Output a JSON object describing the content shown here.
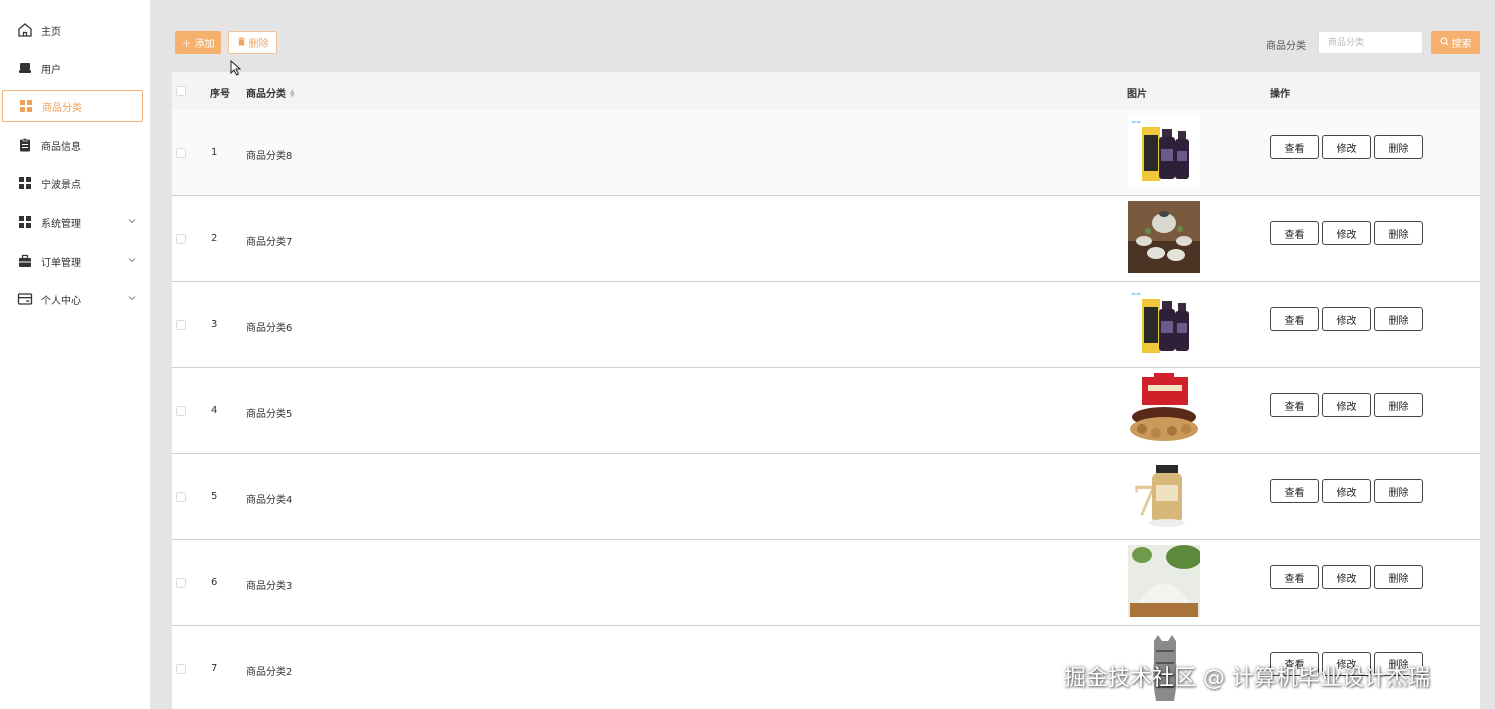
{
  "sidebar": {
    "items": [
      {
        "label": "主页",
        "icon": "home-icon"
      },
      {
        "label": "用户",
        "icon": "user-icon"
      },
      {
        "label": "商品分类",
        "icon": "grid-icon",
        "active": true
      },
      {
        "label": "商品信息",
        "icon": "clipboard-icon"
      },
      {
        "label": "宁波景点",
        "icon": "grid-icon"
      },
      {
        "label": "系统管理",
        "icon": "grid-icon",
        "expandable": true
      },
      {
        "label": "订单管理",
        "icon": "briefcase-icon",
        "expandable": true
      },
      {
        "label": "个人中心",
        "icon": "card-icon",
        "expandable": true
      }
    ]
  },
  "toolbar": {
    "add_label": "添加",
    "delete_label": "删除"
  },
  "search": {
    "label": "商品分类",
    "placeholder": "商品分类",
    "value": "",
    "button_label": "搜索"
  },
  "table": {
    "headers": {
      "index": "序号",
      "category": "商品分类",
      "image": "图片",
      "actions": "操作"
    },
    "rows": [
      {
        "index": "1",
        "category": "商品分类8",
        "image": "wine-bottles"
      },
      {
        "index": "2",
        "category": "商品分类7",
        "image": "tea-set"
      },
      {
        "index": "3",
        "category": "商品分类6",
        "image": "wine-bottles"
      },
      {
        "index": "4",
        "category": "商品分类5",
        "image": "nut-gift-box"
      },
      {
        "index": "5",
        "category": "商品分类4",
        "image": "cosmetic-bottle"
      },
      {
        "index": "6",
        "category": "商品分类3",
        "image": "flour-bowl"
      },
      {
        "index": "7",
        "category": "商品分类2",
        "image": "cat-figure"
      }
    ],
    "action_labels": {
      "view": "查看",
      "edit": "修改",
      "delete": "删除"
    }
  },
  "watermark": "掘金技术社区 @ 计算机毕业设计杰瑞",
  "colors": {
    "accent": "#f6b06e",
    "accent_text": "#f0a15c",
    "content_bg": "#e4e4e4",
    "sidebar_bg": "#ffffff"
  }
}
